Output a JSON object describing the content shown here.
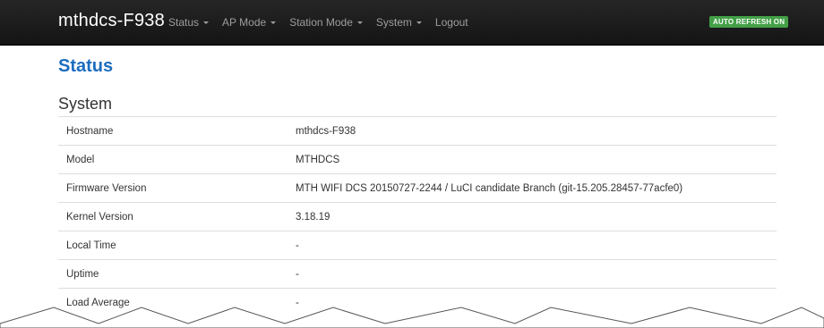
{
  "navbar": {
    "brand": "mthdcs-F938",
    "items": [
      {
        "label": "Status",
        "dropdown": true
      },
      {
        "label": "AP Mode",
        "dropdown": true
      },
      {
        "label": "Station Mode",
        "dropdown": true
      },
      {
        "label": "System",
        "dropdown": true
      },
      {
        "label": "Logout",
        "dropdown": false
      }
    ],
    "auto_refresh": "AUTO REFRESH ON"
  },
  "page": {
    "title": "Status",
    "section": "System"
  },
  "system_table": [
    {
      "label": "Hostname",
      "value": "mthdcs-F938"
    },
    {
      "label": "Model",
      "value": "MTHDCS"
    },
    {
      "label": "Firmware Version",
      "value": "MTH WIFI DCS 20150727-2244 / LuCI candidate Branch (git-15.205.28457-77acfe0)"
    },
    {
      "label": "Kernel Version",
      "value": "3.18.19"
    },
    {
      "label": "Local Time",
      "value": "-"
    },
    {
      "label": "Uptime",
      "value": "-"
    },
    {
      "label": "Load Average",
      "value": "-"
    }
  ],
  "colors": {
    "navbar_bg": "#1f1f1f",
    "title_blue": "#1c6dbf",
    "badge_green": "#43a047"
  }
}
